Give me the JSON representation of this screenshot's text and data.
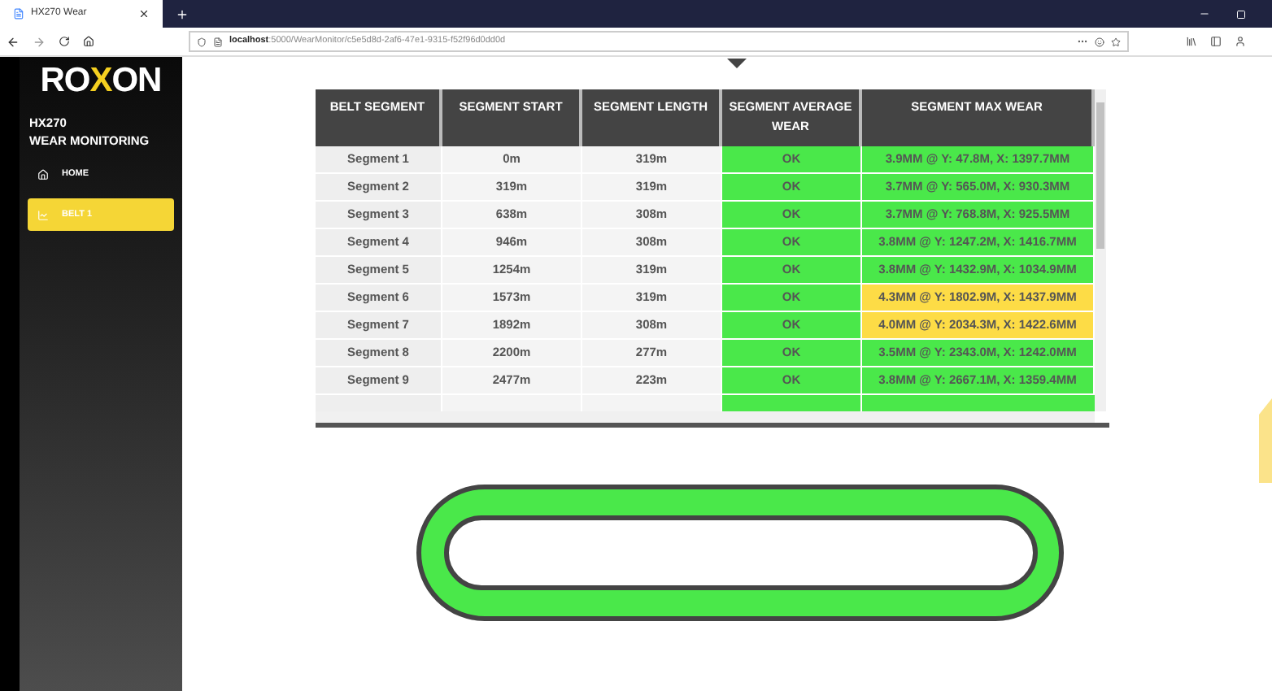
{
  "browser": {
    "tab_title": "HX270 Wear",
    "url_host": "localhost",
    "url_path": ":5000/WearMonitor/c5e5d8d-2af6-47e1-9315-f52f96d0dd0d"
  },
  "sidebar": {
    "logo": {
      "start": "RO",
      "accent": "X",
      "end": "ON"
    },
    "title_lines": [
      "HX270",
      "WEAR MONITORING"
    ],
    "items": [
      {
        "label": "HOME",
        "kind": "home",
        "selected": false
      },
      {
        "label": "BELT 1",
        "kind": "chart",
        "selected": true
      }
    ]
  },
  "table": {
    "columns": [
      "BELT SEGMENT",
      "SEGMENT START",
      "SEGMENT LENGTH",
      "SEGMENT AVERAGE WEAR",
      "SEGMENT MAX WEAR"
    ],
    "rows": [
      {
        "segment": "Segment 1",
        "start": "0m",
        "length": "319m",
        "average": {
          "text": "OK",
          "color": "#4ae84a"
        },
        "max": {
          "text": "3.9MM @ Y: 47.8M, X: 1397.7MM",
          "color": "#4ae84a"
        }
      },
      {
        "segment": "Segment 2",
        "start": "319m",
        "length": "319m",
        "average": {
          "text": "OK",
          "color": "#4ae84a"
        },
        "max": {
          "text": "3.7MM @ Y: 565.0M, X: 930.3MM",
          "color": "#4ae84a"
        }
      },
      {
        "segment": "Segment 3",
        "start": "638m",
        "length": "308m",
        "average": {
          "text": "OK",
          "color": "#4ae84a"
        },
        "max": {
          "text": "3.7MM @ Y: 768.8M, X: 925.5MM",
          "color": "#4ae84a"
        }
      },
      {
        "segment": "Segment 4",
        "start": "946m",
        "length": "308m",
        "average": {
          "text": "OK",
          "color": "#4ae84a"
        },
        "max": {
          "text": "3.8MM @ Y: 1247.2M, X: 1416.7MM",
          "color": "#4ae84a"
        }
      },
      {
        "segment": "Segment 5",
        "start": "1254m",
        "length": "319m",
        "average": {
          "text": "OK",
          "color": "#4ae84a"
        },
        "max": {
          "text": "3.8MM @ Y: 1432.9M, X: 1034.9MM",
          "color": "#4ae84a"
        }
      },
      {
        "segment": "Segment 6",
        "start": "1573m",
        "length": "319m",
        "average": {
          "text": "OK",
          "color": "#4ae84a"
        },
        "max": {
          "text": "4.3MM @ Y: 1802.9M, X: 1437.9MM",
          "color": "#fddc46"
        }
      },
      {
        "segment": "Segment 7",
        "start": "1892m",
        "length": "308m",
        "average": {
          "text": "OK",
          "color": "#4ae84a"
        },
        "max": {
          "text": "4.0MM @ Y: 2034.3M, X: 1422.6MM",
          "color": "#fddc46"
        }
      },
      {
        "segment": "Segment 8",
        "start": "2200m",
        "length": "277m",
        "average": {
          "text": "OK",
          "color": "#4ae84a"
        },
        "max": {
          "text": "3.5MM @ Y: 2343.0M, X: 1242.0MM",
          "color": "#4ae84a"
        }
      },
      {
        "segment": "Segment 9",
        "start": "2477m",
        "length": "223m",
        "average": {
          "text": "OK",
          "color": "#4ae84a"
        },
        "max": {
          "text": "3.8MM @ Y: 2667.1M, X: 1359.4MM",
          "color": "#4ae84a"
        }
      }
    ],
    "partial_row": {
      "average": {
        "color": "#4ae84a"
      },
      "max": {
        "color": "#4ae84a"
      }
    }
  },
  "belt": {
    "color": "#4ae84a"
  }
}
